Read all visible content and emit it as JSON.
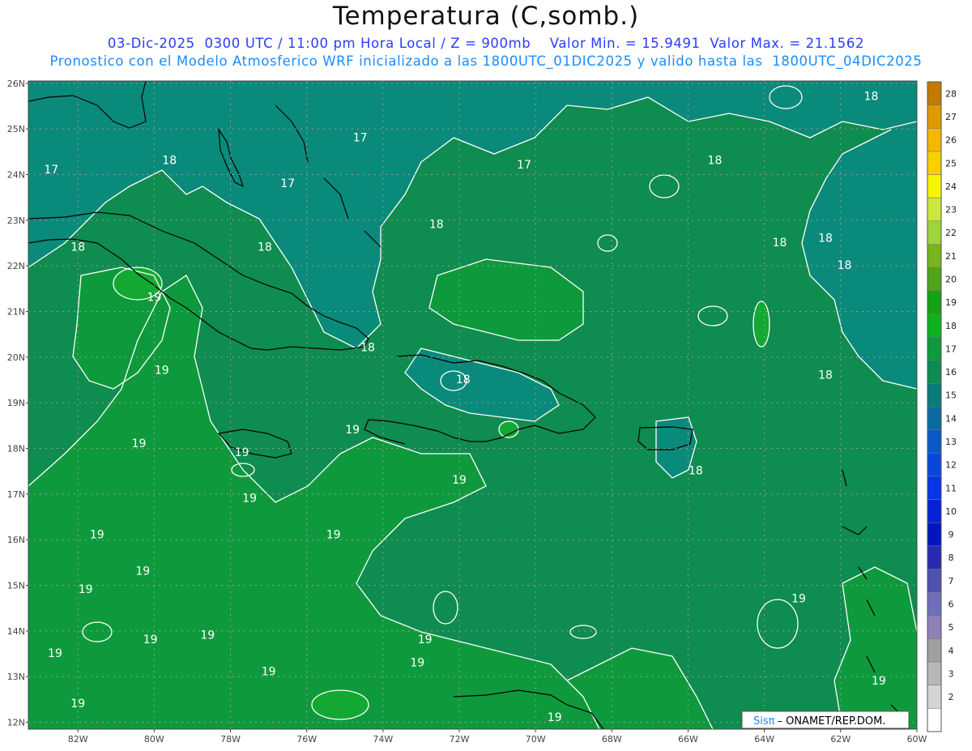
{
  "header": {
    "title": "Temperatura (C,somb.)",
    "subtitle1": "03-Dic-2025  0300 UTC / 11:00 pm Hora Local / Z = 900mb    Valor Min. = 15.9491  Valor Max. = 21.1562",
    "subtitle2": "Pronostico con el Modelo Atmosferico WRF inicializado a las 1800UTC_01DIC2025 y valido hasta las  1800UTC_04DIC2025"
  },
  "map": {
    "lat_labels": [
      "26N",
      "25N",
      "24N",
      "23N",
      "22N",
      "21N",
      "20N",
      "19N",
      "18N",
      "17N",
      "16N",
      "15N",
      "14N",
      "13N",
      "12N"
    ],
    "lon_labels": [
      "82W",
      "80W",
      "78W",
      "76W",
      "74W",
      "72W",
      "70W",
      "68W",
      "66W",
      "64W",
      "62W",
      "60W"
    ],
    "contour_labels": [
      {
        "text": "18",
        "lon": -61.2,
        "lat": 25.7
      },
      {
        "text": "17",
        "lon": -74.6,
        "lat": 24.8
      },
      {
        "text": "17",
        "lon": -70.3,
        "lat": 24.2
      },
      {
        "text": "17",
        "lon": -82.7,
        "lat": 24.1
      },
      {
        "text": "18",
        "lon": -79.6,
        "lat": 24.3
      },
      {
        "text": "17",
        "lon": -76.5,
        "lat": 23.8
      },
      {
        "text": "18",
        "lon": -65.3,
        "lat": 24.3
      },
      {
        "text": "18",
        "lon": -72.6,
        "lat": 22.9
      },
      {
        "text": "18",
        "lon": -82.0,
        "lat": 22.4
      },
      {
        "text": "18",
        "lon": -77.1,
        "lat": 22.4
      },
      {
        "text": "18",
        "lon": -62.4,
        "lat": 22.6
      },
      {
        "text": "18",
        "lon": -63.6,
        "lat": 22.5
      },
      {
        "text": "18",
        "lon": -61.9,
        "lat": 22.0
      },
      {
        "text": "19",
        "lon": -80.0,
        "lat": 21.3
      },
      {
        "text": "18",
        "lon": -74.4,
        "lat": 20.2
      },
      {
        "text": "19",
        "lon": -79.8,
        "lat": 19.7
      },
      {
        "text": "18",
        "lon": -71.9,
        "lat": 19.5
      },
      {
        "text": "18",
        "lon": -62.4,
        "lat": 19.6
      },
      {
        "text": "19",
        "lon": -80.4,
        "lat": 18.1
      },
      {
        "text": "19",
        "lon": -77.7,
        "lat": 17.9
      },
      {
        "text": "19",
        "lon": -74.8,
        "lat": 18.4
      },
      {
        "text": "19",
        "lon": -72.0,
        "lat": 17.3
      },
      {
        "text": "18",
        "lon": -65.8,
        "lat": 17.5
      },
      {
        "text": "19",
        "lon": -77.5,
        "lat": 16.9
      },
      {
        "text": "19",
        "lon": -75.3,
        "lat": 16.1
      },
      {
        "text": "19",
        "lon": -81.5,
        "lat": 16.1
      },
      {
        "text": "19",
        "lon": -80.3,
        "lat": 15.3
      },
      {
        "text": "19",
        "lon": -81.8,
        "lat": 14.9
      },
      {
        "text": "19",
        "lon": -63.1,
        "lat": 14.7
      },
      {
        "text": "19",
        "lon": -82.6,
        "lat": 13.5
      },
      {
        "text": "19",
        "lon": -80.1,
        "lat": 13.8
      },
      {
        "text": "19",
        "lon": -78.6,
        "lat": 13.9
      },
      {
        "text": "19",
        "lon": -72.9,
        "lat": 13.8
      },
      {
        "text": "19",
        "lon": -77.0,
        "lat": 13.1
      },
      {
        "text": "19",
        "lon": -73.1,
        "lat": 13.3
      },
      {
        "text": "19",
        "lon": -82.0,
        "lat": 12.4
      },
      {
        "text": "19",
        "lon": -69.5,
        "lat": 12.1
      },
      {
        "text": "19",
        "lon": -61.0,
        "lat": 12.9
      }
    ],
    "colors": {
      "field_17": "#0a8a7a",
      "field_18": "#0f8c4f",
      "field_19": "#0e9a3c",
      "field_20": "#13a832",
      "contour": "#ffffff",
      "coast": "#000000",
      "grid": "#9a9a9a"
    }
  },
  "colorbar": {
    "labels": [
      "28",
      "27",
      "26",
      "25",
      "24",
      "23",
      "22",
      "21",
      "20",
      "19",
      "18",
      "17",
      "16",
      "15",
      "14",
      "13",
      "12",
      "11",
      "10",
      "9",
      "8",
      "7",
      "6",
      "5",
      "4",
      "3",
      "2"
    ],
    "colors": [
      "#c27a00",
      "#e09a00",
      "#f5b800",
      "#f8d000",
      "#f5f500",
      "#cde83c",
      "#9fd43c",
      "#78b41e",
      "#4fa41a",
      "#16a016",
      "#10b01e",
      "#0e9a3c",
      "#0e8a52",
      "#0b7a7a",
      "#0c6aa0",
      "#0b58c8",
      "#0a46dc",
      "#0834e8",
      "#0622d8",
      "#0414c0",
      "#2a2ab0",
      "#5050b0",
      "#6f6fb8",
      "#8f80b8",
      "#a0a0a0",
      "#b8b8b8",
      "#d4d4d4",
      "#ffffff"
    ]
  },
  "credit": {
    "brand": "Sisπ",
    "text": "– ONAMET/REP.DOM."
  }
}
